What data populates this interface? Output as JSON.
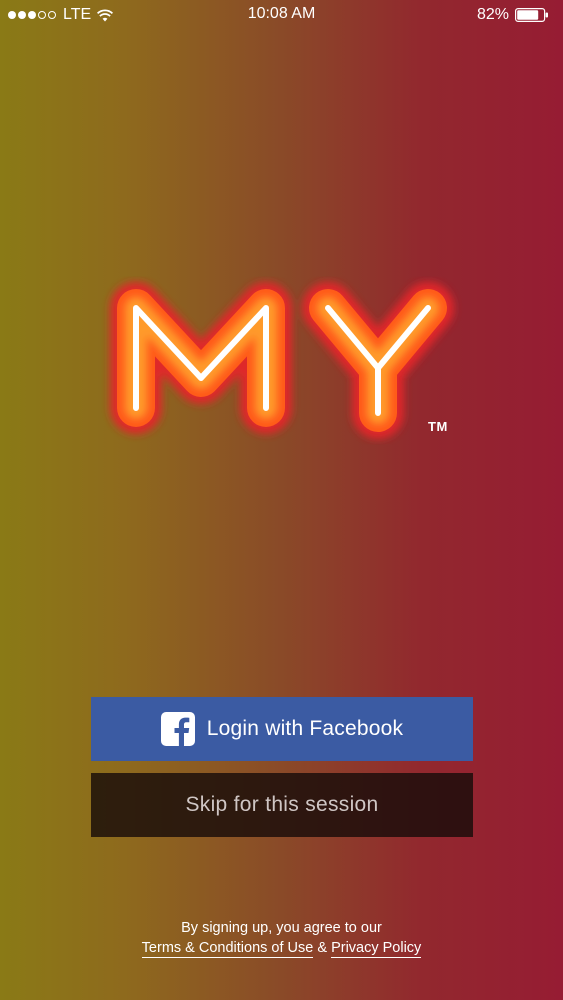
{
  "status_bar": {
    "carrier": "LTE",
    "time": "10:08 AM",
    "battery_percent": "82%",
    "signal_bars_filled": 3,
    "signal_bars_total": 5,
    "battery_level": 0.82
  },
  "logo": {
    "text": "MY",
    "trademark": "TM"
  },
  "buttons": {
    "facebook_label": "Login with Facebook",
    "skip_label": "Skip for this session"
  },
  "legal": {
    "intro": "By signing up, you agree to our",
    "terms_link": "Terms & Conditions of Use",
    "separator": "&",
    "privacy_link": "Privacy Policy"
  },
  "colors": {
    "facebook_blue": "#3b5ba3",
    "neon_orange": "#ff5a1a",
    "neon_core": "#ffffff"
  },
  "icons": {
    "wifi": "wifi-icon",
    "battery": "battery-icon",
    "facebook": "facebook-icon"
  }
}
